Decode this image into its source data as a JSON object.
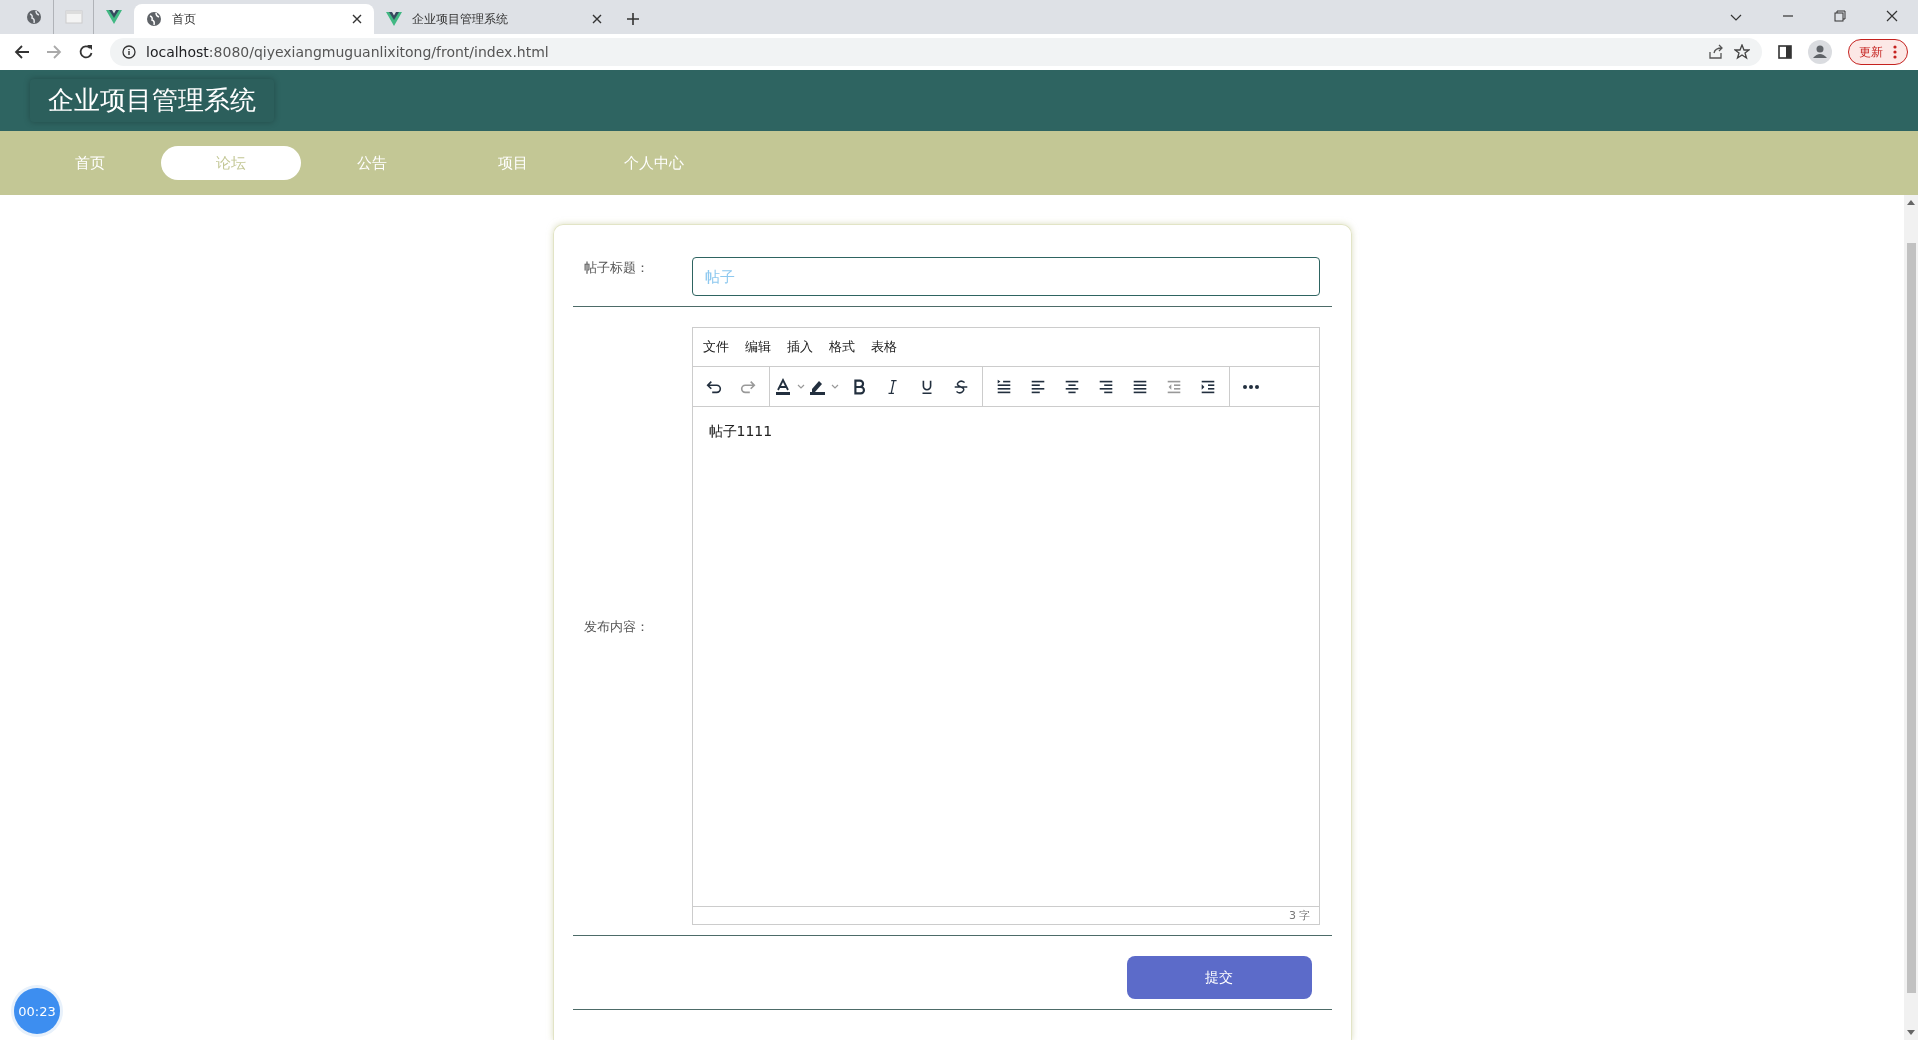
{
  "browser": {
    "pinned_tabs": [
      {
        "kind": "globe"
      },
      {
        "kind": "blank"
      },
      {
        "kind": "vue"
      }
    ],
    "tabs": [
      {
        "kind": "globe",
        "title": "首页",
        "selected": true
      },
      {
        "kind": "vue",
        "title": "企业项目管理系统",
        "selected": false
      }
    ],
    "url_host": "localhost",
    "url_rest": ":8080/qiyexiangmuguanlixitong/front/index.html",
    "update_button": "更新"
  },
  "site_title": "企业项目管理系统",
  "nav": [
    {
      "label": "首页",
      "selected": false
    },
    {
      "label": "论坛",
      "selected": true
    },
    {
      "label": "公告",
      "selected": false
    },
    {
      "label": "项目",
      "selected": false
    },
    {
      "label": "个人中心",
      "selected": false
    }
  ],
  "form": {
    "title_label": "帖子标题：",
    "title_placeholder": "帖子",
    "content_label": "发布内容：",
    "editor": {
      "menus": [
        "文件",
        "编辑",
        "插入",
        "格式",
        "表格"
      ],
      "toolbar": [
        {
          "tools": [
            {
              "kind": "undo",
              "disabled": false
            },
            {
              "kind": "redo",
              "disabled": true
            }
          ]
        },
        {
          "tools": [
            {
              "kind": "text-color",
              "disabled": false
            },
            {
              "kind": "highlight",
              "disabled": false
            },
            {
              "kind": "bold",
              "disabled": false
            },
            {
              "kind": "italic",
              "disabled": false
            },
            {
              "kind": "underline",
              "disabled": false
            },
            {
              "kind": "strike",
              "disabled": false
            }
          ]
        },
        {
          "tools": [
            {
              "kind": "line-height",
              "disabled": false
            },
            {
              "kind": "align-left",
              "disabled": false
            },
            {
              "kind": "align-center",
              "disabled": false
            },
            {
              "kind": "align-right",
              "disabled": false
            },
            {
              "kind": "justify",
              "disabled": false
            },
            {
              "kind": "outdent",
              "disabled": true
            },
            {
              "kind": "indent",
              "disabled": false
            }
          ]
        },
        {
          "tools": [
            {
              "kind": "more",
              "disabled": false
            }
          ]
        }
      ],
      "content": "帖子1111",
      "word_count": "3 字"
    },
    "submit_button": "提交"
  },
  "timer": "00:23"
}
